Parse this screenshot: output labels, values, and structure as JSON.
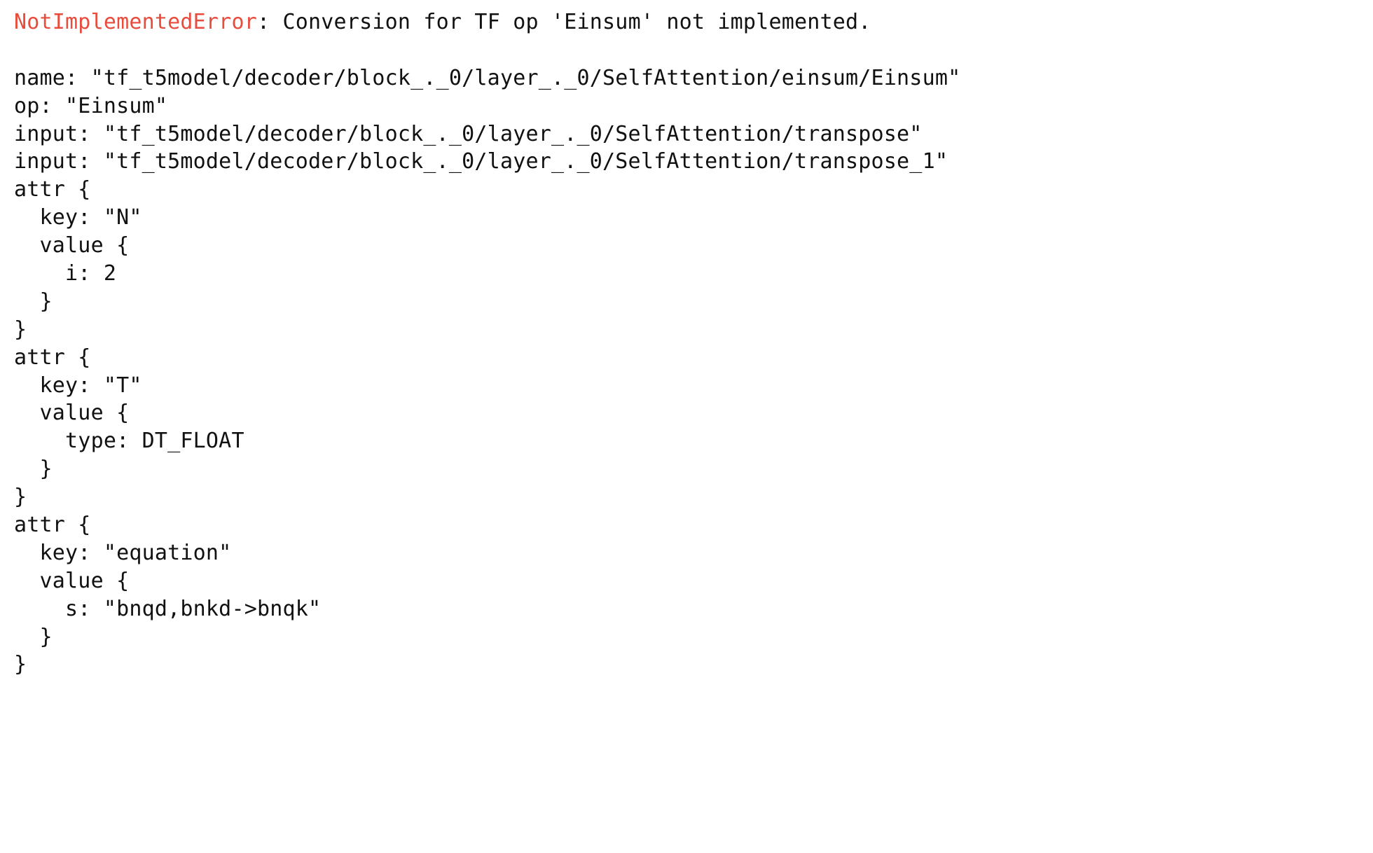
{
  "error": {
    "name": "NotImplementedError",
    "message": ": Conversion for TF op 'Einsum' not implemented."
  },
  "node": {
    "name_line": "name: \"tf_t5model/decoder/block_._0/layer_._0/SelfAttention/einsum/Einsum\"",
    "op_line": "op: \"Einsum\"",
    "input1_line": "input: \"tf_t5model/decoder/block_._0/layer_._0/SelfAttention/transpose\"",
    "input2_line": "input: \"tf_t5model/decoder/block_._0/layer_._0/SelfAttention/transpose_1\"",
    "attrs": [
      {
        "open": "attr {",
        "key": "  key: \"N\"",
        "value_open": "  value {",
        "value_body": "    i: 2",
        "value_close": "  }",
        "close": "}"
      },
      {
        "open": "attr {",
        "key": "  key: \"T\"",
        "value_open": "  value {",
        "value_body": "    type: DT_FLOAT",
        "value_close": "  }",
        "close": "}"
      },
      {
        "open": "attr {",
        "key": "  key: \"equation\"",
        "value_open": "  value {",
        "value_body": "    s: \"bnqd,bnkd->bnqk\"",
        "value_close": "  }",
        "close": "}"
      }
    ]
  }
}
